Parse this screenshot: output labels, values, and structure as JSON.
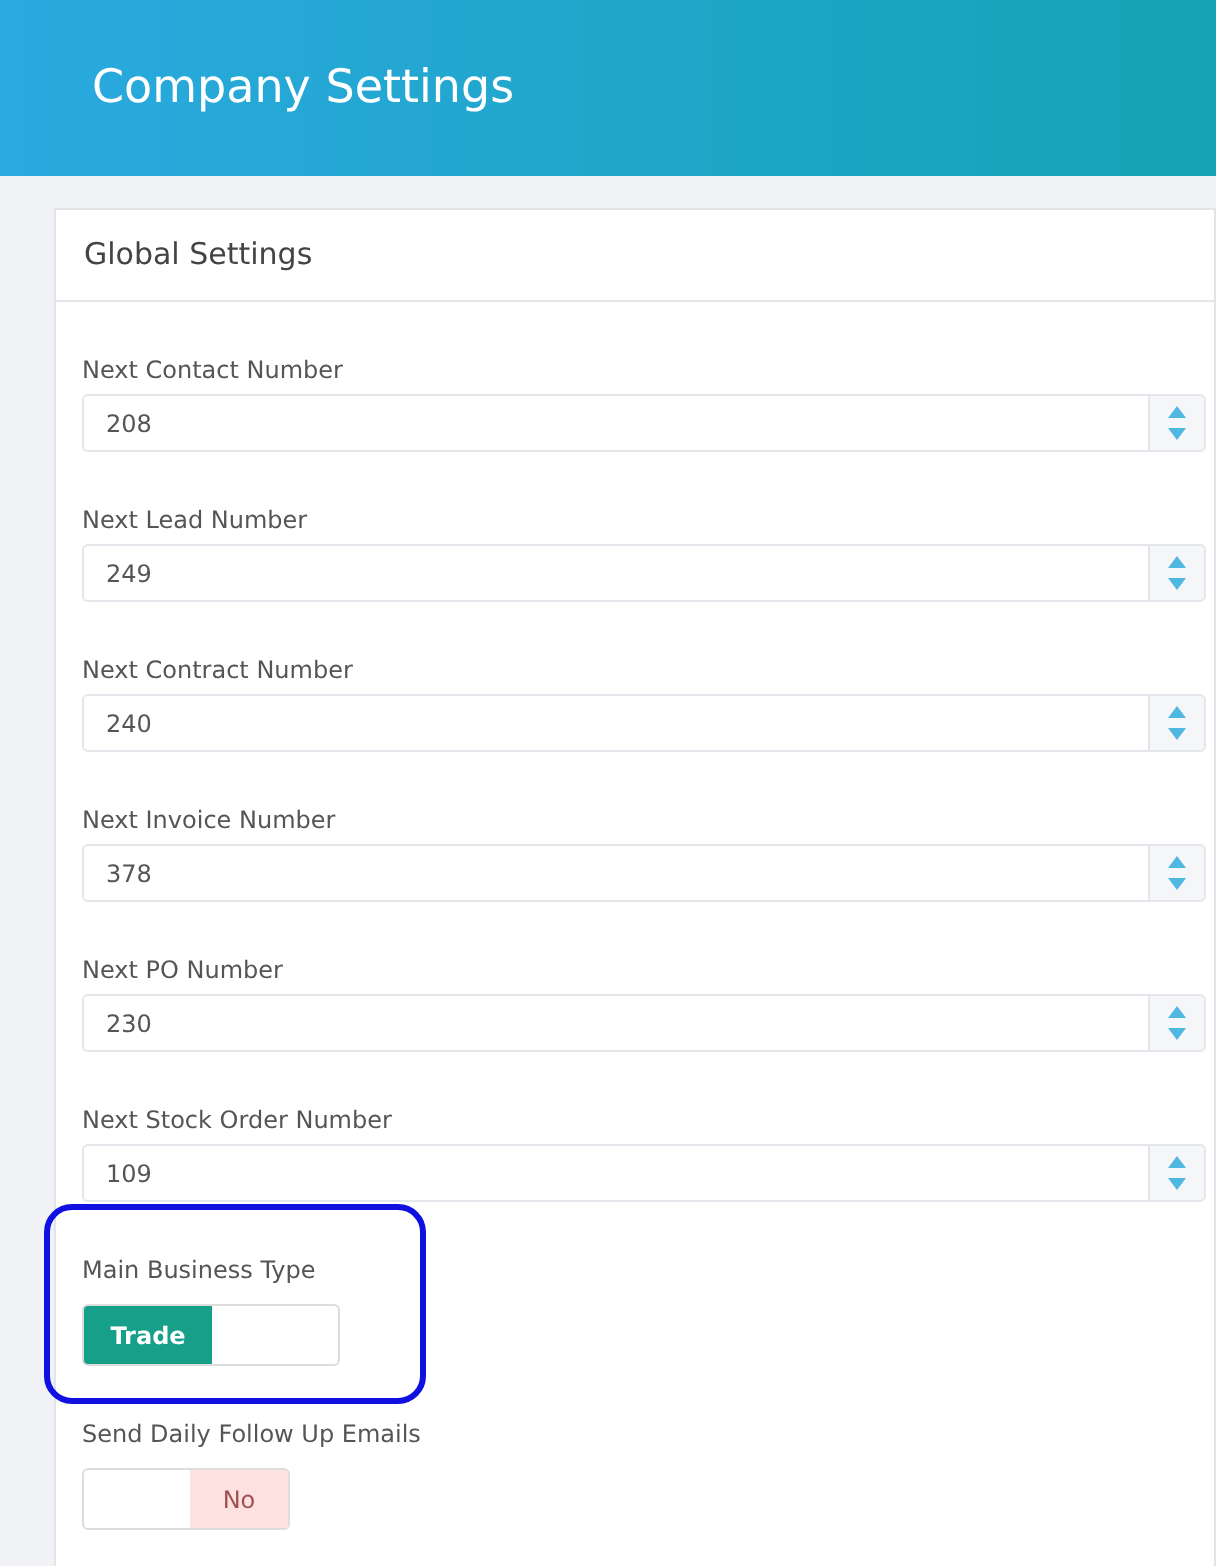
{
  "header": {
    "title": "Company Settings"
  },
  "card": {
    "title": "Global Settings",
    "fields": [
      {
        "kind": "number",
        "label": "Next Contact Number",
        "value": "208"
      },
      {
        "kind": "number",
        "label": "Next Lead Number",
        "value": "249"
      },
      {
        "kind": "number",
        "label": "Next Contract Number",
        "value": "240"
      },
      {
        "kind": "number",
        "label": "Next Invoice Number",
        "value": "378"
      },
      {
        "kind": "number",
        "label": "Next PO Number",
        "value": "230"
      },
      {
        "kind": "number",
        "label": "Next Stock Order Number",
        "value": "109"
      },
      {
        "kind": "toggle",
        "label": "Main Business Type",
        "text": "Trade",
        "on": true,
        "highlighted": true
      },
      {
        "kind": "toggle",
        "label": "Send Daily Follow Up Emails",
        "text": "No",
        "on": false,
        "highlighted": false
      }
    ]
  }
}
